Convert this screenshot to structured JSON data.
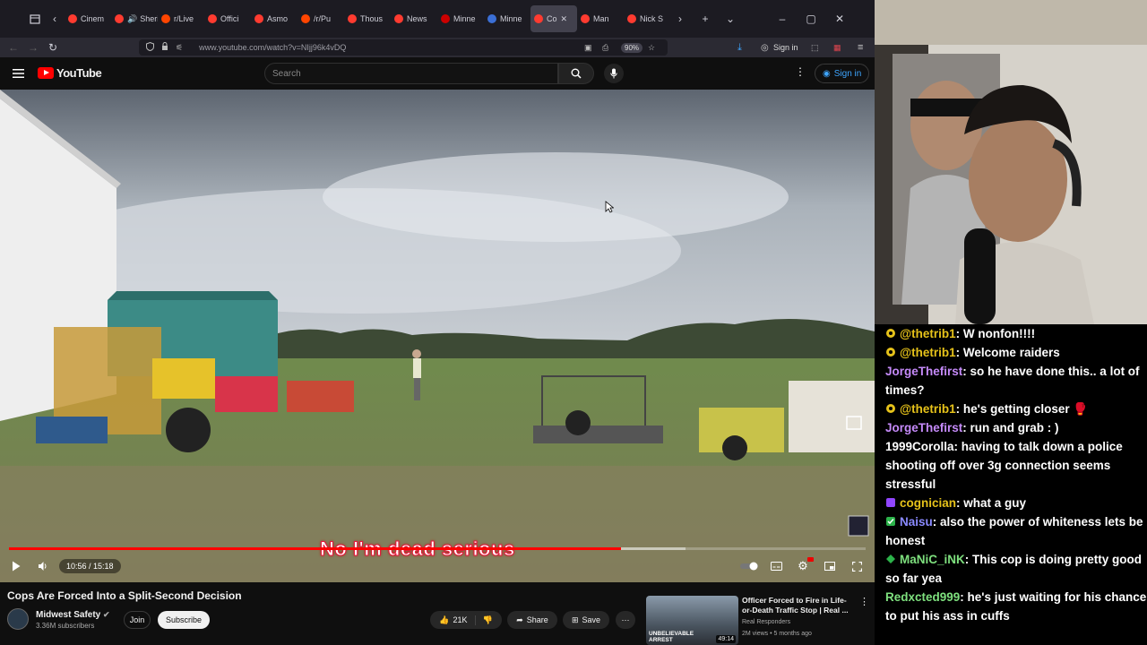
{
  "browser": {
    "tabs": [
      {
        "label": "Cinem",
        "color": "#ff3b30"
      },
      {
        "label": "Sherif",
        "color": "#ff3b30"
      },
      {
        "label": "r/Live",
        "color": "#ff4500"
      },
      {
        "label": "Offici",
        "color": "#ff3b30"
      },
      {
        "label": "Asmo",
        "color": "#ff3b30"
      },
      {
        "label": "/r/Pu",
        "color": "#ff4500"
      },
      {
        "label": "Thous",
        "color": "#ff3b30"
      },
      {
        "label": "News",
        "color": "#ff3b30"
      },
      {
        "label": "Minne",
        "color": "#cc0000"
      },
      {
        "label": "Minne",
        "color": "#3b6fd6"
      },
      {
        "label": "Co",
        "color": "#ff3b30"
      },
      {
        "label": "Man",
        "color": "#ff3b30"
      },
      {
        "label": "Nick S",
        "color": "#ff3b30"
      }
    ],
    "url": "www.youtube.com/watch?v=NIjj96k4vDQ",
    "zoom": "90%",
    "signin_label": "Sign in"
  },
  "youtube": {
    "logo_text": "YouTube",
    "search_placeholder": "Search",
    "signin_label": "Sign in"
  },
  "player": {
    "subtitle": "No I'm dead serious",
    "current_time": "10:56",
    "duration": "15:18",
    "time_display": "10:56 / 15:18",
    "progress_fraction": 0.714,
    "buffered_fraction": 0.79
  },
  "video_info": {
    "title": "Cops Are Forced Into a Split-Second Decision",
    "channel": "Midwest Safety",
    "subscribers": "3.36M subscribers",
    "join_label": "Join",
    "subscribe_label": "Subscribe",
    "likes": "21K",
    "share_label": "Share",
    "save_label": "Save"
  },
  "recommended": {
    "title": "Officer Forced to Fire in Life-or-Death Traffic Stop | Real ...",
    "channel": "Real Responders",
    "meta": "2M views • 5 months ago",
    "duration": "49:14",
    "thumb_text": "UNBELIEVABLE ARREST"
  },
  "chat": {
    "messages": [
      {
        "user": "@thetrib1",
        "text": ": W nonfon!!!!",
        "color": "#e6c21a",
        "badge": "gear"
      },
      {
        "user": "@thetrib1",
        "text": ": Welcome raiders",
        "color": "#e6c21a",
        "badge": "gear"
      },
      {
        "user": "JorgeThefirst",
        "text": ": so he have done this.. a lot of times?",
        "color": "#c58af9",
        "badge": ""
      },
      {
        "user": "@thetrib1",
        "text": ": he's getting closer 🥊",
        "color": "#e6c21a",
        "badge": "gear"
      },
      {
        "user": "JorgeThefirst",
        "text": ": run and grab : )",
        "color": "#c58af9",
        "badge": ""
      },
      {
        "user": "1999Corolla",
        "text": ": having to talk down a police shooting off over 3g connection seems stressful",
        "color": "#ffffff",
        "badge": ""
      },
      {
        "user": "cognician",
        "text": ": what a guy",
        "color": "#e6c21a",
        "badge": "square"
      },
      {
        "user": "Naisu",
        "text": ": also the power of whiteness lets be honest",
        "color": "#8a8aff",
        "badge": "check"
      },
      {
        "user": "MaNiC_iNK",
        "text": ": This cop is doing pretty good so far yea",
        "color": "#7ee07e",
        "badge": "diamond"
      },
      {
        "user": "Redxcted999",
        "text": ": he's just waiting for his chance to put his ass in cuffs",
        "color": "#7ee07e",
        "badge": ""
      }
    ]
  }
}
